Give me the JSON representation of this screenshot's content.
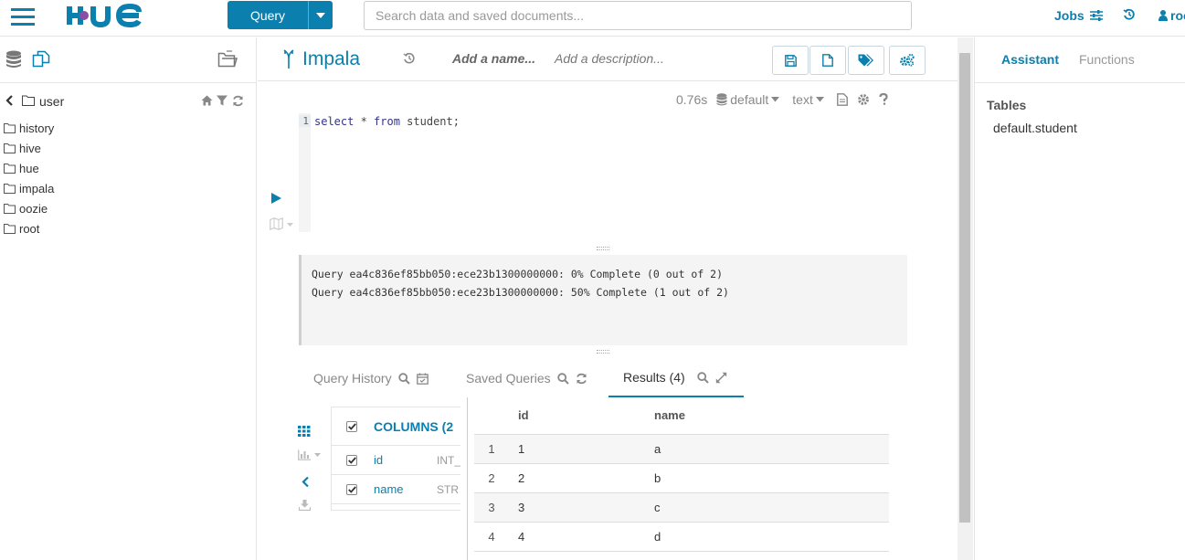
{
  "topbar": {
    "logo_text": "HUE",
    "query_button_label": "Query",
    "search_placeholder": "Search data and saved documents...",
    "jobs_label": "Jobs",
    "user_label": "roo"
  },
  "left_panel": {
    "path_name": "user",
    "folders": [
      "history",
      "hive",
      "hue",
      "impala",
      "oozie",
      "root"
    ]
  },
  "snippet": {
    "title": "Impala",
    "name_placeholder": "Add a name...",
    "description_placeholder": "Add a description...",
    "execution_time": "0.76s",
    "database": "default",
    "format": "text",
    "line_number": "1",
    "code": "select * from student;"
  },
  "log_lines": [
    "Query ea4c836ef85bb050:ece23b1300000000: 0% Complete (0 out of 2)",
    "Query ea4c836ef85bb050:ece23b1300000000: 50% Complete (1 out of 2)"
  ],
  "tabs": {
    "history": "Query History",
    "saved": "Saved Queries",
    "results": "Results (4)"
  },
  "columns_panel": {
    "header": "COLUMNS (2",
    "columns": [
      {
        "name": "id",
        "type": "INT_"
      },
      {
        "name": "name",
        "type": "STR"
      }
    ]
  },
  "results": {
    "headers": [
      "id",
      "name"
    ],
    "rows": [
      {
        "n": "1",
        "id": "1",
        "name": "a"
      },
      {
        "n": "2",
        "id": "2",
        "name": "b"
      },
      {
        "n": "3",
        "id": "3",
        "name": "c"
      },
      {
        "n": "4",
        "id": "4",
        "name": "d"
      }
    ]
  },
  "right_panel": {
    "assistant_tab": "Assistant",
    "functions_tab": "Functions",
    "tables_heading": "Tables",
    "table_item": "default.student"
  },
  "colors": {
    "accent": "#0b7fad",
    "muted": "#888888",
    "log_background": "#f4f4f4"
  }
}
